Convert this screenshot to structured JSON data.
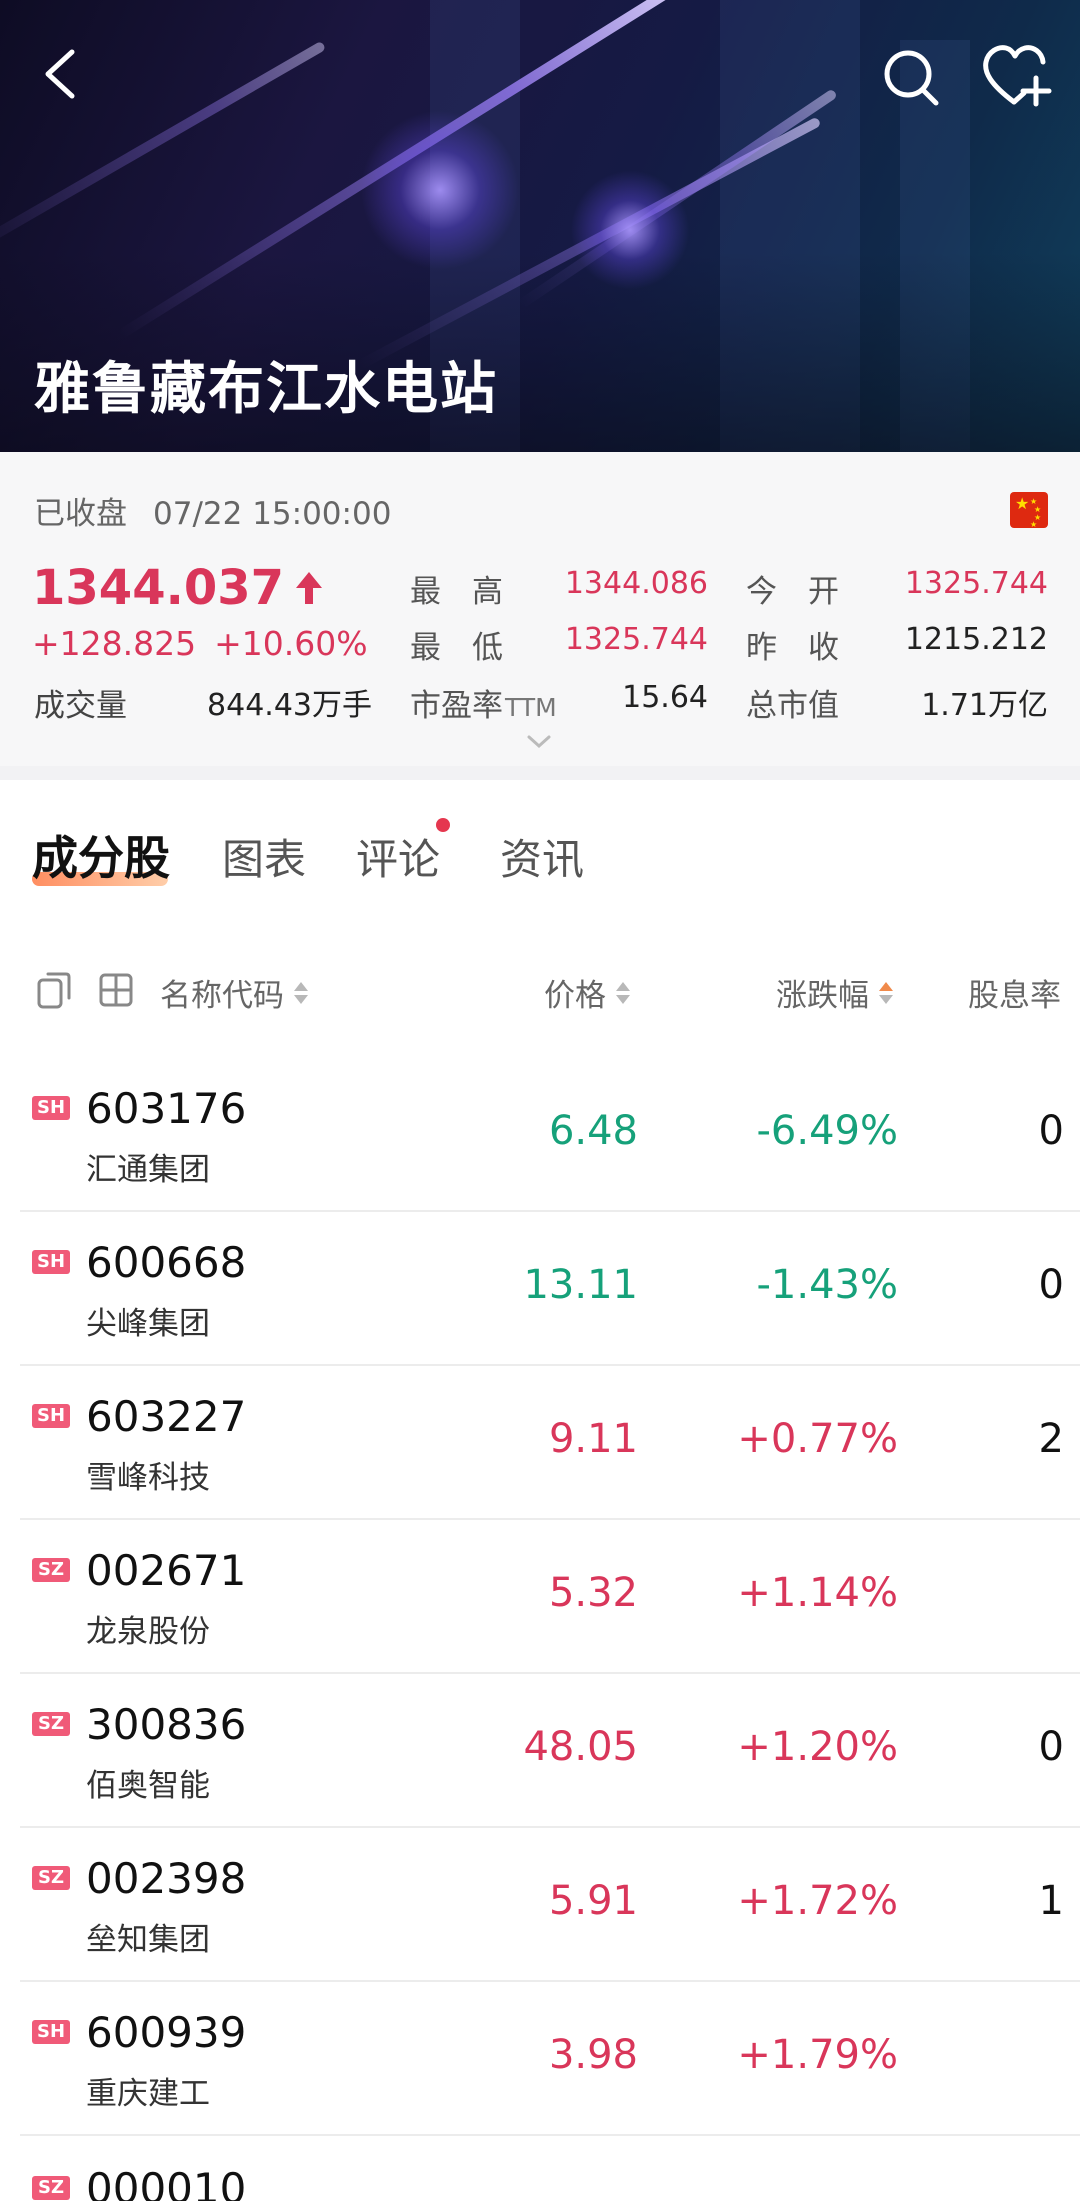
{
  "banner": {
    "title": "雅鲁藏布江水电站"
  },
  "quote": {
    "status": "已收盘",
    "time": "07/22 15:00:00",
    "price": "1344.037",
    "change": "+128.825",
    "change_pct": "+10.60%",
    "volume_label": "成交量",
    "volume_value": "844.43万手",
    "high_label": "最　高",
    "high_value": "1344.086",
    "open_label": "今　开",
    "open_value": "1325.744",
    "low_label": "最　低",
    "low_value": "1325.744",
    "prev_close_label": "昨　收",
    "prev_close_value": "1215.212",
    "pe_label": "市盈率",
    "pe_suffix": "TTM",
    "pe_value": "15.64",
    "mcap_label": "总市值",
    "mcap_value": "1.71万亿"
  },
  "tabs": [
    "成分股",
    "图表",
    "评论",
    "资讯"
  ],
  "table": {
    "col_name": "名称代码",
    "col_price": "价格",
    "col_change": "涨跌幅",
    "col_dividend": "股息率",
    "rows": [
      {
        "market": "SH",
        "code": "603176",
        "name": "汇通集团",
        "price": "6.48",
        "change": "-6.49%",
        "dividend": "0",
        "dir": "down"
      },
      {
        "market": "SH",
        "code": "600668",
        "name": "尖峰集团",
        "price": "13.11",
        "change": "-1.43%",
        "dividend": "0",
        "dir": "down"
      },
      {
        "market": "SH",
        "code": "603227",
        "name": "雪峰科技",
        "price": "9.11",
        "change": "+0.77%",
        "dividend": "2",
        "dir": "up"
      },
      {
        "market": "SZ",
        "code": "002671",
        "name": "龙泉股份",
        "price": "5.32",
        "change": "+1.14%",
        "dividend": "",
        "dir": "up"
      },
      {
        "market": "SZ",
        "code": "300836",
        "name": "佰奥智能",
        "price": "48.05",
        "change": "+1.20%",
        "dividend": "0",
        "dir": "up"
      },
      {
        "market": "SZ",
        "code": "002398",
        "name": "垒知集团",
        "price": "5.91",
        "change": "+1.72%",
        "dividend": "1",
        "dir": "up"
      },
      {
        "market": "SH",
        "code": "600939",
        "name": "重庆建工",
        "price": "3.98",
        "change": "+1.79%",
        "dividend": "",
        "dir": "up"
      },
      {
        "market": "SZ",
        "code": "000010",
        "name": "",
        "price": "",
        "change": "",
        "dividend": "",
        "dir": "up"
      }
    ]
  },
  "colors": {
    "up": "#d9365a",
    "down": "#16a17a",
    "accent": "#f08a4b"
  }
}
